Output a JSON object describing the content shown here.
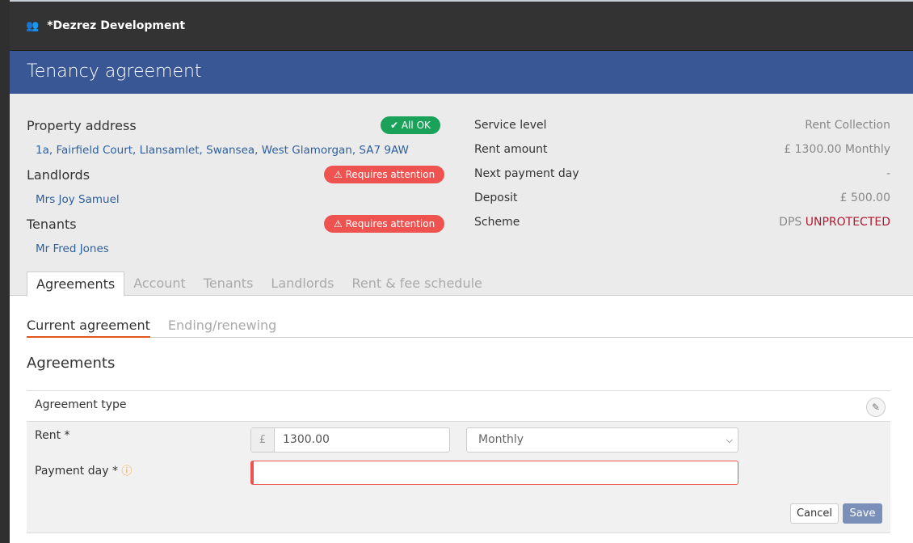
{
  "app": {
    "org_name": "*Dezrez Development",
    "org_icon": "users-icon"
  },
  "header": {
    "title": "Tenancy agreement"
  },
  "summary": {
    "property": {
      "label": "Property address",
      "status": "All OK",
      "address": "1a, Fairfield Court, Llansamlet, Swansea, West Glamorgan, SA7 9AW"
    },
    "landlords": {
      "label": "Landlords",
      "status": "Requires attention",
      "name": "Mrs Joy Samuel"
    },
    "tenants": {
      "label": "Tenants",
      "status": "Requires attention",
      "name": "Mr Fred Jones"
    },
    "details": [
      {
        "label": "Service level",
        "value": "Rent Collection"
      },
      {
        "label": "Rent amount",
        "value": "£ 1300.00 Monthly"
      },
      {
        "label": "Next payment day",
        "value": "-"
      },
      {
        "label": "Deposit",
        "value": "£ 500.00"
      },
      {
        "label": "Scheme",
        "value": "DPS",
        "value_status": "UNPROTECTED"
      }
    ],
    "colors": {
      "ok": "#1aa25a",
      "warn": "#ef5350",
      "header": "#3a5795"
    }
  },
  "tabs": [
    "Agreements",
    "Account",
    "Tenants",
    "Landlords",
    "Rent & fee schedule"
  ],
  "subtabs": [
    "Current agreement",
    "Ending/renewing"
  ],
  "section": {
    "title": "Agreements",
    "agreement_type_label": "Agreement type"
  },
  "form": {
    "rent_label": "Rent *",
    "currency": "£",
    "rent_value": "1300.00",
    "frequency": "Monthly",
    "payment_day_label": "Payment day *",
    "payment_day_value": "",
    "cancel": "Cancel",
    "save": "Save"
  }
}
